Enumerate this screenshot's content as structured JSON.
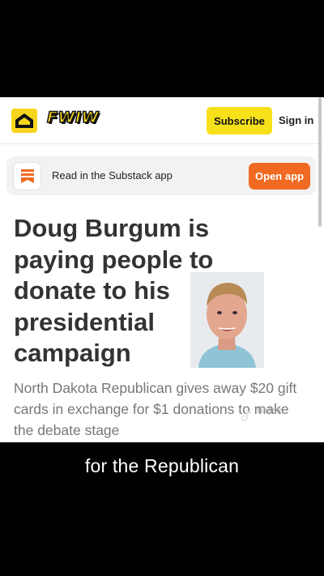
{
  "header": {
    "logo_icon": "envelope-arrow-icon",
    "brand": "FWIW",
    "subscribe_label": "Subscribe",
    "signin_label": "Sign in",
    "brand_color": "#f7d51d"
  },
  "app_banner": {
    "icon": "substack-icon",
    "text": "Read in the Substack app",
    "open_label": "Open app",
    "accent": "#f06a22"
  },
  "article": {
    "title": "Doug Burgum is paying people to donate to his presidential campaign",
    "subtitle": "North Dakota Republican gives away $20 gift cards in exchange for $1 donations to make the debate stage"
  },
  "overlay": {
    "watermark": "TikTok",
    "caption": "for the Republican"
  }
}
